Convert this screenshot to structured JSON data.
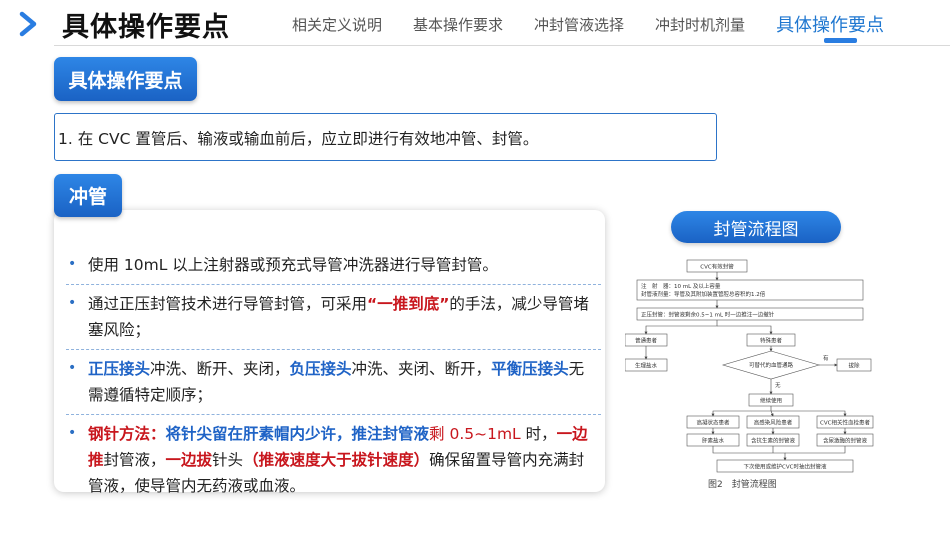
{
  "header": {
    "title": "具体操作要点",
    "nav": [
      "相关定义说明",
      "基本操作要求",
      "冲封管液选择",
      "冲封时机剂量",
      "具体操作要点"
    ],
    "active_index": 4
  },
  "section_ops": {
    "badge": "具体操作要点"
  },
  "point1": "1. 在 CVC 置管后、输液或输血前后，应立即进行有效地冲管、封管。",
  "flush": {
    "badge": "冲管",
    "b1": "使用 10mL 以上注射器或预充式导管冲洗器进行导管封管。",
    "b2_pre": "通过正压封管技术进行导管封管，可采用",
    "b2_em": "“一推到底”",
    "b2_post": "的手法，减少导管堵塞风险；",
    "b3_em1": "正压接头",
    "b3_t1": "冲洗、断开、夹闭，",
    "b3_em2": "负压接头",
    "b3_t2": "冲洗、夹闭、断开，",
    "b3_em3": "平衡压接头",
    "b3_t3": "无需遵循特定顺序；",
    "b4_em1": "钢针方法：",
    "b4_em2": "将针尖留在肝素帽内少许，推注封管液",
    "b4_red1": "剩 0.5~1mL",
    "b4_t1": " 时，",
    "b4_em3": "一边推",
    "b4_t2": "封管液，",
    "b4_em4": "一边拔",
    "b4_t3": "针头",
    "b4_em5": "（推液速度大于拔针速度）",
    "b4_t4": "确保留置导管内充满封管液，使导管内无药液或血液。"
  },
  "flowchart": {
    "title": "封管流程图",
    "n_start": "CVC有效封管",
    "n_info1": "注　射　器：10 mL 及以上容量",
    "n_info2": "封管液剂量：导管及其附加装置管腔总容积的1.2倍",
    "n_pos": "正压封管：封管液剩余0.5~1 mL 时一边推注一边撤针",
    "n_normal": "普通患者",
    "n_special": "特殊患者",
    "n_saline": "生理盐水",
    "n_q": "可替代的血管通路",
    "n_yes": "有",
    "n_no": "无",
    "n_remove": "拔除",
    "n_keep": "继续使用",
    "n_g1": "高凝状态患者",
    "n_g2": "高感染风险患者",
    "n_g3": "CVC相关性血栓患者",
    "n_s1": "肝素盐水",
    "n_s2": "含抗生素的封管液",
    "n_s3": "含尿激酶的封管液",
    "n_end": "下次使用或维护CVC时抽出封管液",
    "caption": "图2　封管流程图"
  },
  "colors": {
    "accent": "#2a7de1",
    "red_em": "#c8161d",
    "blue_em": "#1f63c6"
  }
}
